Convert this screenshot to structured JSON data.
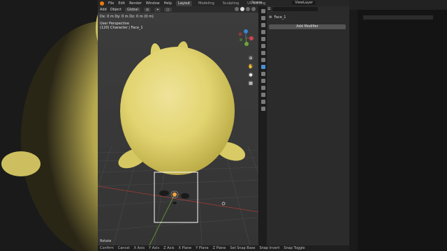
{
  "menu": {
    "items": [
      "File",
      "Edit",
      "Render",
      "Window",
      "Help"
    ],
    "workspaces": [
      "Layout",
      "Modeling",
      "Sculpting",
      "UV Editing"
    ],
    "active_workspace": "Layout",
    "scene": "Scene",
    "view_layer": "ViewLayer"
  },
  "viewport": {
    "header": {
      "add": "Add",
      "object": "Object",
      "orientation": "Global"
    },
    "dimensions": "Dx: 0 m  Dy: 0 m  Dz: 0 m (0 m)",
    "perspective": "User Perspective",
    "object_info": "(120) Character | Face_1",
    "operation": "Rotate"
  },
  "statusbar": {
    "items": [
      "Confirm",
      "Cancel",
      "X Axis",
      "Y Axis",
      "Z Axis",
      "X Plane",
      "Y Plane",
      "Z Plane",
      "Set Snap Base",
      "Snap Invert",
      "Snap Toggle"
    ]
  },
  "properties": {
    "object_name": "Face_1",
    "add_modifier_label": "Add Modifier",
    "search_placeholder": ""
  },
  "colors": {
    "accent": "#e87d0d",
    "viewport_bg": "#3a3a3a",
    "character": "#e6d779",
    "active_tab": "#4b8fd6"
  }
}
